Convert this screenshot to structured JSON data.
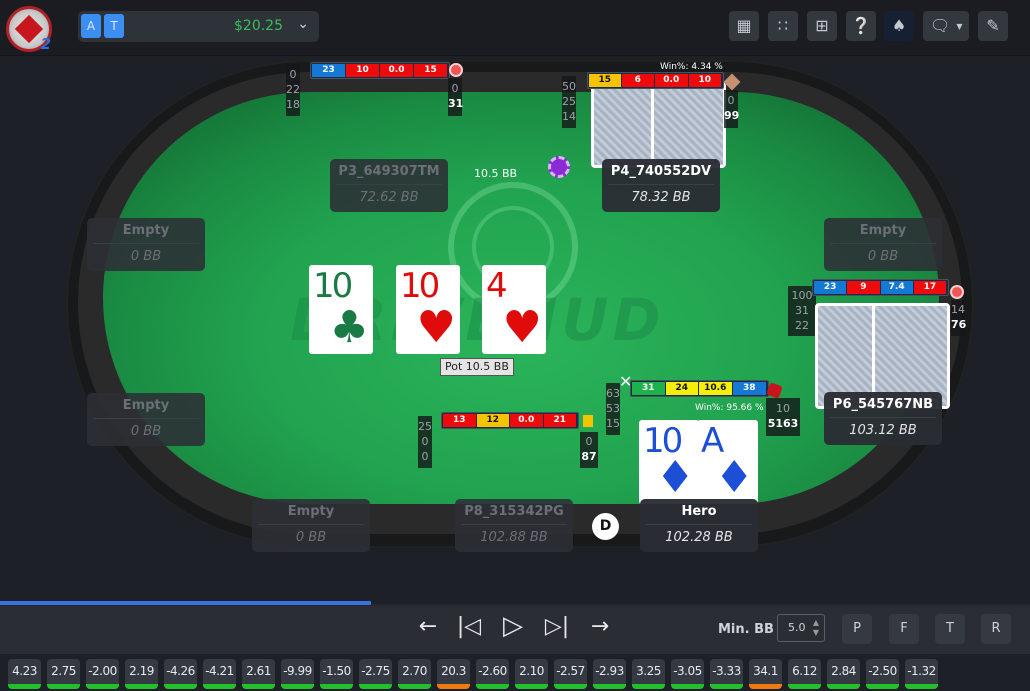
{
  "header": {
    "account_avatars": [
      "A",
      "T"
    ],
    "balance": "$20.25",
    "balance_color": "#3bbf5a",
    "toolbar_icons": [
      "calculator-icon",
      "grid-icon",
      "layout-icon",
      "help-chip-icon",
      "ace-spade-icon",
      "chat-icon",
      "edit-icon"
    ]
  },
  "table": {
    "brand_text": "DRIVEHUD",
    "pot_label": "Pot 10.5 BB",
    "bet_label": "10.5 BB",
    "dealer_label": "D",
    "board": [
      {
        "rank": "10",
        "suit": "♣",
        "color": "#1a7a43"
      },
      {
        "rank": "10",
        "suit": "♥",
        "color": "#e00b0b"
      },
      {
        "rank": "4",
        "suit": "♥",
        "color": "#e00b0b"
      }
    ],
    "seats": [
      {
        "name": "P3_649307TM",
        "stack": "72.62 BB",
        "active": false
      },
      {
        "name": "P4_740552DV",
        "stack": "78.32 BB",
        "active": true
      },
      {
        "name": "Empty",
        "stack": "0 BB",
        "active": false
      },
      {
        "name": "Empty",
        "stack": "0 BB",
        "active": false
      },
      {
        "name": "Empty",
        "stack": "0 BB",
        "active": false
      },
      {
        "name": "P6_545767NB",
        "stack": "103.12 BB",
        "active": true
      },
      {
        "name": "Empty",
        "stack": "0 BB",
        "active": false
      },
      {
        "name": "P8_315342PG",
        "stack": "102.88 BB",
        "active": false
      },
      {
        "name": "Hero",
        "stack": "102.28 BB",
        "active": true
      }
    ],
    "hero_cards": [
      {
        "rank": "10",
        "suit": "♦",
        "color": "#1d4fd6"
      },
      {
        "rank": "A",
        "suit": "♦",
        "color": "#1d4fd6"
      }
    ],
    "huds": {
      "p3": {
        "stats": [
          "23",
          "10",
          "0.0",
          "15"
        ],
        "left": [
          "0",
          "22",
          "18"
        ],
        "right": [
          "0",
          "31"
        ]
      },
      "p4": {
        "stats": [
          "15",
          "6",
          "0.0",
          "10"
        ],
        "left": [
          "50",
          "25",
          "14"
        ],
        "right": [
          "0",
          "99"
        ],
        "win": "Win%: 4.34 %"
      },
      "p6": {
        "stats": [
          "23",
          "9",
          "7.4",
          "17"
        ],
        "left": [
          "100",
          "31",
          "22"
        ],
        "right": [
          "14",
          "76"
        ]
      },
      "p8": {
        "stats": [
          "13",
          "12",
          "0.0",
          "21"
        ],
        "left": [
          "25",
          "0",
          "0"
        ],
        "right": [
          "0",
          "87"
        ]
      },
      "hero": {
        "stats": [
          "31",
          "24",
          "10.6",
          "38"
        ],
        "left": [
          "63",
          "53",
          "15"
        ],
        "right": [
          "10",
          "5163"
        ],
        "win": "Win%: 95.66 %"
      }
    }
  },
  "replay": {
    "progress": 0.36,
    "min_bb_label": "Min. BB",
    "min_bb_value": "5.0",
    "street_buttons": [
      "P",
      "F",
      "T",
      "R"
    ]
  },
  "hand_history": [
    {
      "value": "4.23",
      "color": "#22c02a"
    },
    {
      "value": "2.75",
      "color": "#22c02a"
    },
    {
      "value": "-2.00",
      "color": "#22c02a"
    },
    {
      "value": "2.19",
      "color": "#22c02a"
    },
    {
      "value": "-4.26",
      "color": "#22c02a"
    },
    {
      "value": "-4.21",
      "color": "#22c02a"
    },
    {
      "value": "2.61",
      "color": "#22c02a"
    },
    {
      "value": "-9.99",
      "color": "#22c02a"
    },
    {
      "value": "-1.50",
      "color": "#22c02a"
    },
    {
      "value": "-2.75",
      "color": "#22c02a"
    },
    {
      "value": "2.70",
      "color": "#22c02a"
    },
    {
      "value": "20.3",
      "color": "#f07a12"
    },
    {
      "value": "-2.60",
      "color": "#22c02a"
    },
    {
      "value": "2.10",
      "color": "#22c02a"
    },
    {
      "value": "-2.57",
      "color": "#22c02a"
    },
    {
      "value": "-2.93",
      "color": "#22c02a"
    },
    {
      "value": "3.25",
      "color": "#22c02a"
    },
    {
      "value": "-3.05",
      "color": "#22c02a"
    },
    {
      "value": "-3.33",
      "color": "#22c02a"
    },
    {
      "value": "34.1",
      "color": "#f07a12"
    },
    {
      "value": "6.12",
      "color": "#22c02a"
    },
    {
      "value": "2.84",
      "color": "#22c02a"
    },
    {
      "value": "-2.50",
      "color": "#22c02a"
    },
    {
      "value": "-1.32",
      "color": "#22c02a"
    }
  ]
}
